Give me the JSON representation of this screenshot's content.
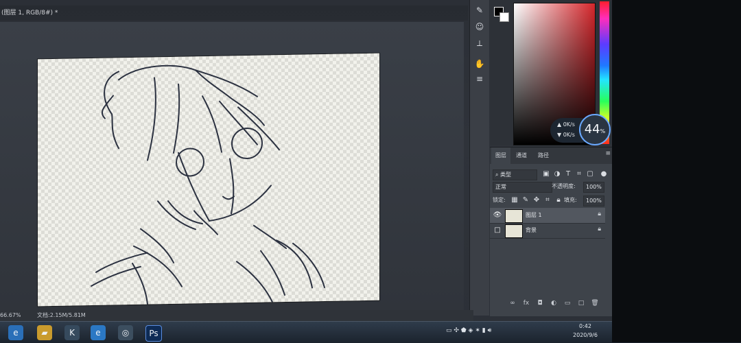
{
  "app": {
    "document_tab_title": "(图层 1, RGB/8#) *"
  },
  "color_panel": {
    "speed": {
      "up": "0K/s",
      "down": "0K/s"
    },
    "percent_widget": {
      "value": "44",
      "unit": "%"
    },
    "colors": {
      "foreground": "#000000",
      "background": "#ffffff",
      "field_hue": "#d5262b"
    }
  },
  "layers_panel": {
    "tabs": [
      "图层",
      "通道",
      "路径"
    ],
    "filter_label": "类型",
    "blend_mode": "正常",
    "opacity_label": "不透明度:",
    "opacity_value": "100%",
    "lock_label": "锁定:",
    "fill_label": "填充:",
    "fill_value": "100%",
    "layers": [
      {
        "name": "图层 1",
        "visible": true,
        "selected": true
      },
      {
        "name": "背景",
        "visible": false,
        "selected": false
      }
    ],
    "footer_icons": [
      "link-icon",
      "fx-icon",
      "mask-icon",
      "adjustment-icon",
      "group-icon",
      "new-layer-icon",
      "trash-icon"
    ]
  },
  "status_bar": {
    "zoom": "66.67%",
    "doc_info": "文档:2.15M/5.81M"
  },
  "taskbar": {
    "time": "0:42",
    "date": "2020/9/6",
    "apps": [
      {
        "name": "ie-icon",
        "glyph": "e"
      },
      {
        "name": "folder-icon",
        "glyph": "▰"
      },
      {
        "name": "k-icon",
        "glyph": "K"
      },
      {
        "name": "edge-icon",
        "glyph": "e"
      },
      {
        "name": "browser-icon",
        "glyph": "◎"
      },
      {
        "name": "photoshop-icon",
        "glyph": "Ps"
      }
    ]
  }
}
